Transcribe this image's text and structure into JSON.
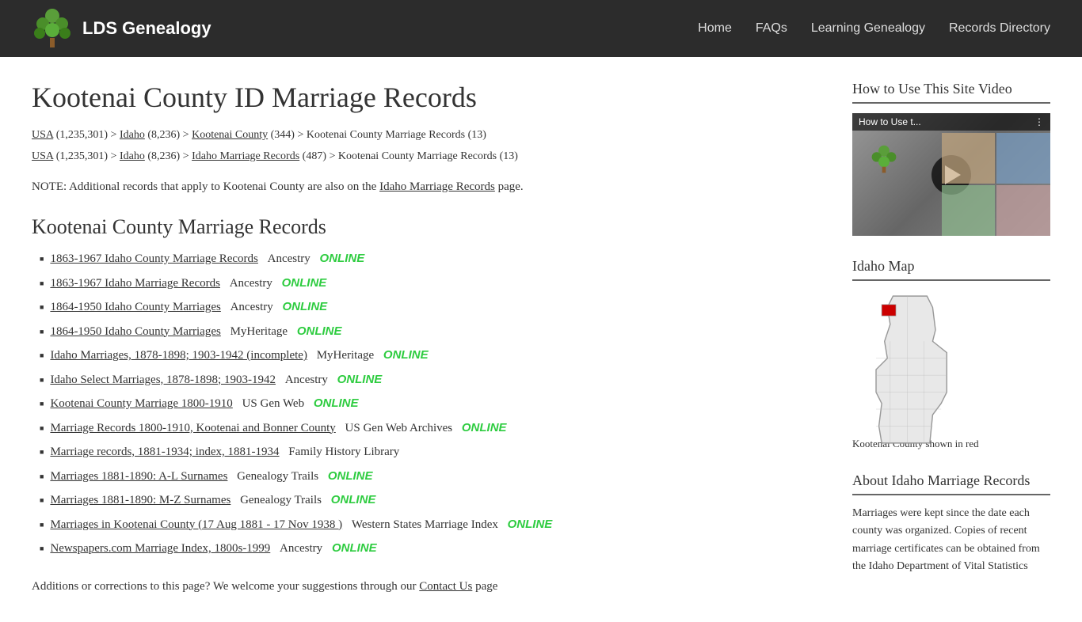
{
  "header": {
    "logo_text": "LDS Genealogy",
    "nav_items": [
      "Home",
      "FAQs",
      "Learning Genealogy",
      "Records Directory"
    ]
  },
  "main": {
    "page_title": "Kootenai County ID Marriage Records",
    "breadcrumbs": [
      {
        "line": "USA (1,235,301) > Idaho (8,236) > Kootenai County (344) > Kootenai County Marriage Records (13)",
        "links": [
          "USA",
          "Idaho",
          "Kootenai County"
        ]
      },
      {
        "line": "USA (1,235,301) > Idaho (8,236) > Idaho Marriage Records (487) > Kootenai County Marriage Records (13)",
        "links": [
          "USA",
          "Idaho",
          "Idaho Marriage Records"
        ]
      }
    ],
    "note": "NOTE: Additional records that apply to Kootenai County are also on the Idaho Marriage Records page.",
    "section_title": "Kootenai County Marriage Records",
    "records": [
      {
        "link": "1863-1967 Idaho County Marriage Records",
        "provider": "Ancestry",
        "online": true
      },
      {
        "link": "1863-1967 Idaho Marriage Records",
        "provider": "Ancestry",
        "online": true
      },
      {
        "link": "1864-1950 Idaho County Marriages",
        "provider": "Ancestry",
        "online": true
      },
      {
        "link": "1864-1950 Idaho County Marriages",
        "provider": "MyHeritage",
        "online": true
      },
      {
        "link": "Idaho Marriages, 1878-1898; 1903-1942 (incomplete)",
        "provider": "MyHeritage",
        "online": true
      },
      {
        "link": "Idaho Select Marriages, 1878-1898; 1903-1942",
        "provider": "Ancestry",
        "online": true
      },
      {
        "link": "Kootenai County Marriage 1800-1910",
        "provider": "US Gen Web",
        "online": true
      },
      {
        "link": "Marriage Records 1800-1910, Kootenai and Bonner County",
        "provider": "US Gen Web Archives",
        "online": true
      },
      {
        "link": "Marriage records, 1881-1934; index, 1881-1934",
        "provider": "Family History Library",
        "online": false
      },
      {
        "link": "Marriages 1881-1890: A-L Surnames",
        "provider": "Genealogy Trails",
        "online": true
      },
      {
        "link": "Marriages 1881-1890: M-Z Surnames",
        "provider": "Genealogy Trails",
        "online": true
      },
      {
        "link": "Marriages in Kootenai County (17 Aug 1881 - 17 Nov 1938 )",
        "provider": "Western States Marriage Index",
        "online": true
      },
      {
        "link": "Newspapers.com Marriage Index, 1800s-1999",
        "provider": "Ancestry",
        "online": true
      }
    ],
    "additions_text": "Additions or corrections to this page? We welcome your suggestions through our Contact Us page"
  },
  "sidebar": {
    "video_section": {
      "title": "How to Use This Site Video",
      "video_label": "How to Use t...",
      "video_dots": "⋮"
    },
    "map_section": {
      "title": "Idaho Map",
      "caption": "Kootenai County shown in red"
    },
    "about_section": {
      "title": "About Idaho Marriage Records",
      "text": "Marriages were kept since the date each county was organized. Copies of recent marriage certificates can be obtained from the Idaho Department of Vital Statistics"
    }
  },
  "online_label": "ONLINE"
}
